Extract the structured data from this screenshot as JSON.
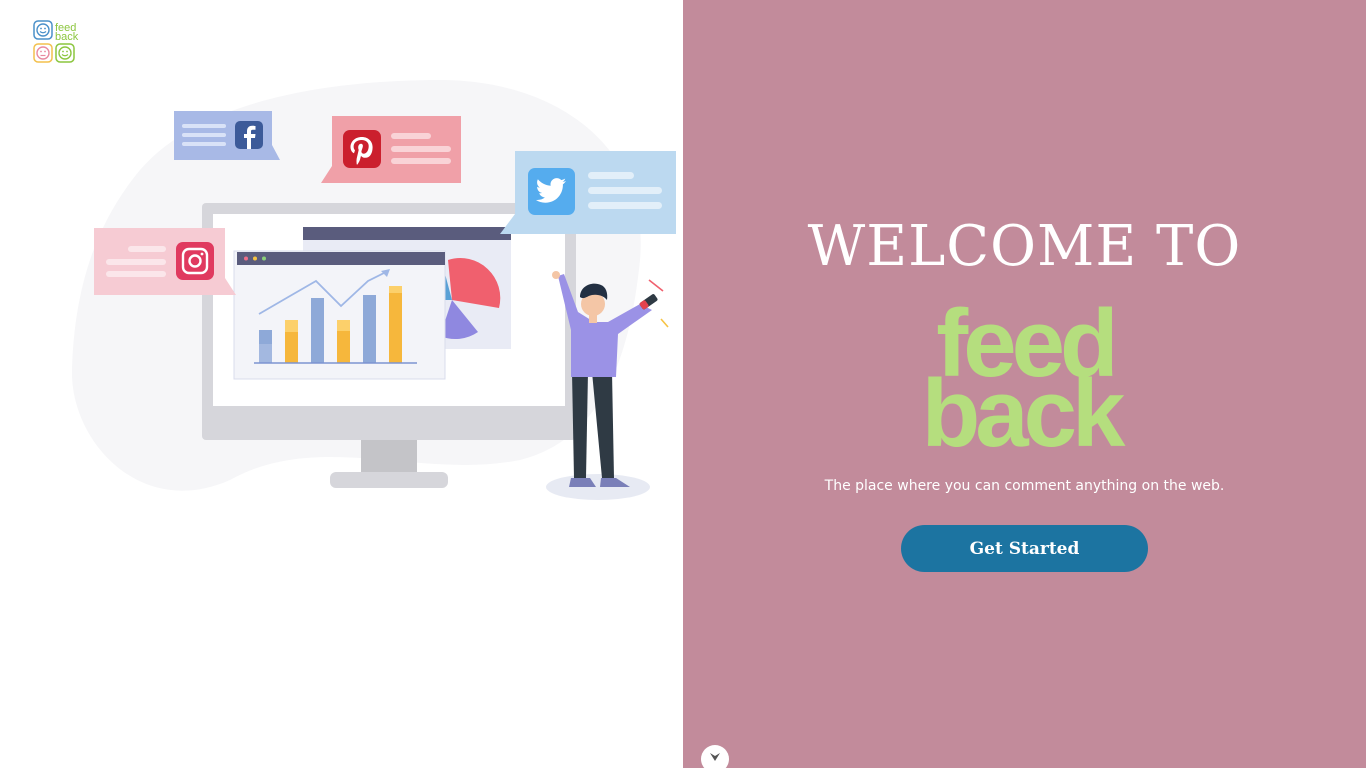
{
  "logo": {
    "line1": "feed",
    "line2": "back"
  },
  "welcome": {
    "title": "WELCOME TO"
  },
  "brand": {
    "line1": "feed",
    "line2": "back",
    "color": "#b5de7e"
  },
  "tagline": "The place where you can comment anything on the web.",
  "cta": {
    "label": "Get Started",
    "color": "#1c74a1"
  },
  "colors": {
    "panel": "#c28b9b",
    "background": "#ffffff"
  },
  "icons": [
    "facebook-icon",
    "pinterest-icon",
    "twitter-icon",
    "instagram-icon",
    "chevron-down-icon"
  ]
}
